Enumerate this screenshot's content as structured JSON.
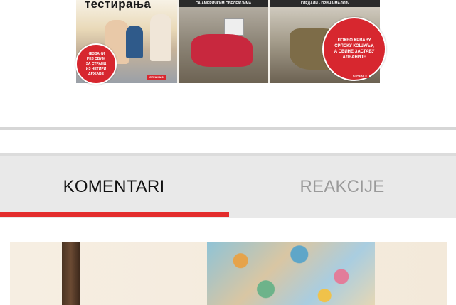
{
  "newspaper": {
    "headline": "тестирања",
    "panel2_banner": "СА АМЕРИЧКИМ ОБЕЛЕЖЈИМА",
    "panel3_banner": "ГЛЕДАЛИ - ПРИЧА МАЛОЋ",
    "badge_left": [
      "НЕЗВАНИ",
      "РЕЗ СВИМ",
      "ЗА СТРАНЦ",
      "ИЗ ЧЕТИРИ",
      "ДРЖАВЕ"
    ],
    "badge_right": [
      "ПОКЕО КРВАВУ",
      "СРПСКУ КОШУЉУ,",
      "А СВИНЕ ЗАСТАВУ",
      "АЛБАНИЈЕ"
    ],
    "page_tag_1": "СТРАНА 3",
    "page_tag_2": "СТРАНА 5"
  },
  "tabs": {
    "comments_label": "KOMENTARI",
    "reactions_label": "REAKCIJE",
    "active": "comments"
  },
  "colors": {
    "accent": "#e32c2c",
    "tab_background": "#e9e9e9",
    "inactive_tab_text": "#9a9a9a"
  }
}
